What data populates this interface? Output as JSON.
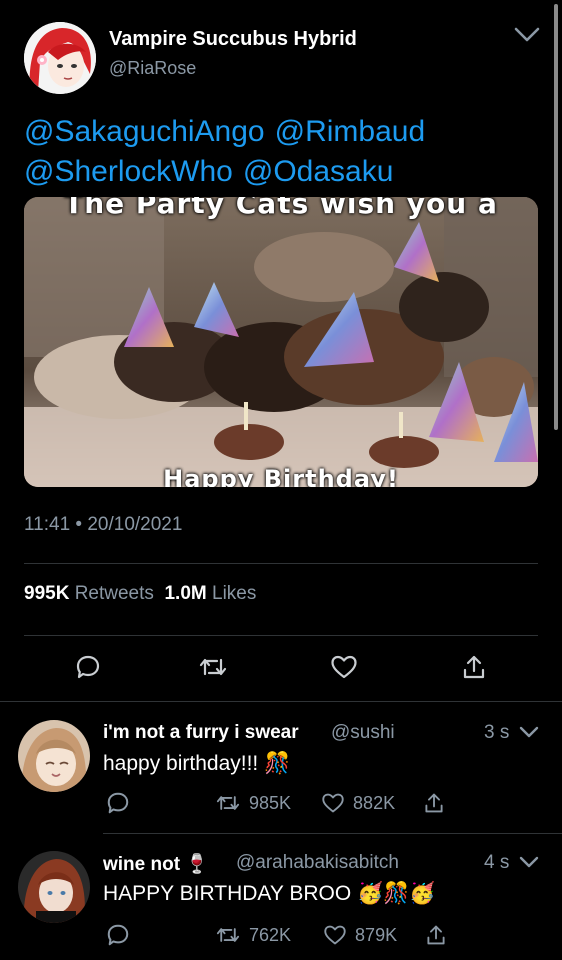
{
  "tweet": {
    "author_name": "Vampire Succubus Hybrid",
    "author_handle": "@RiaRose",
    "mentions": [
      "@SakaguchiAngo",
      "@Rimbaud",
      "@SherlockWho",
      "@Odasaku"
    ],
    "image_caption_top": "The Party Cats wish you a",
    "image_caption_bottom": "Happy Birthday!",
    "timestamp": "11:41 • 20/10/2021",
    "retweets_count": "995K",
    "retweets_label": "Retweets",
    "likes_count": "1.0M",
    "likes_label": "Likes"
  },
  "replies": [
    {
      "name": "i'm not a furry i swear",
      "handle": "@sushi",
      "time": "3 s",
      "text": "happy birthday!!! 🎊",
      "retweets": "985K",
      "likes": "882K"
    },
    {
      "name": "wine not 🍷",
      "handle": "@arahabakisabitch",
      "time": "4 s",
      "text": "HAPPY BIRTHDAY BROO 🥳🎊🥳",
      "retweets": "762K",
      "likes": "879K"
    }
  ],
  "colors": {
    "accent": "#1d9bf0",
    "muted": "#8b98a5",
    "divider": "#2f3336",
    "background": "#000000"
  }
}
